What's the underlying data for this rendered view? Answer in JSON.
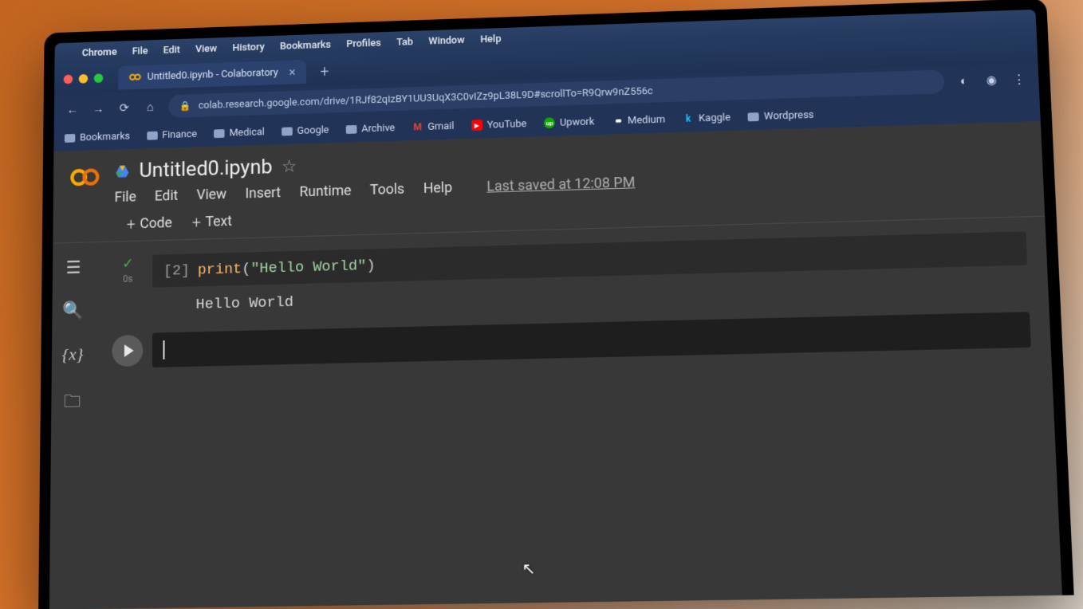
{
  "macos": {
    "app": "Chrome",
    "menus": [
      "File",
      "Edit",
      "View",
      "History",
      "Bookmarks",
      "Profiles",
      "Tab",
      "Window",
      "Help"
    ]
  },
  "browser": {
    "tab_title": "Untitled0.ipynb - Colaboratory",
    "url": "colab.research.google.com/drive/1RJf82qIzBY1UU3UqX3C0vIZz9pL38L9D#scrollTo=R9Qrw9nZ556c",
    "bookmarks": [
      {
        "label": "Bookmarks",
        "kind": "folder"
      },
      {
        "label": "Finance",
        "kind": "folder"
      },
      {
        "label": "Medical",
        "kind": "folder"
      },
      {
        "label": "Google",
        "kind": "folder"
      },
      {
        "label": "Archive",
        "kind": "folder"
      },
      {
        "label": "Gmail",
        "kind": "icon",
        "glyph": "M",
        "color": "#ea4335"
      },
      {
        "label": "YouTube",
        "kind": "icon",
        "glyph": "▶",
        "color": "#ff0000"
      },
      {
        "label": "Upwork",
        "kind": "icon",
        "glyph": "up",
        "color": "#14a800"
      },
      {
        "label": "Medium",
        "kind": "icon",
        "glyph": "●●",
        "color": "#ffffff"
      },
      {
        "label": "Kaggle",
        "kind": "icon",
        "glyph": "k",
        "color": "#20beff"
      },
      {
        "label": "Wordpress",
        "kind": "folder"
      }
    ]
  },
  "colab": {
    "doc_title": "Untitled0.ipynb",
    "menus": [
      "File",
      "Edit",
      "View",
      "Insert",
      "Runtime",
      "Tools",
      "Help"
    ],
    "toolbar": {
      "code_label": "Code",
      "text_label": "Text"
    },
    "last_saved": "Last saved at 12:08 PM",
    "cell1": {
      "exec_count": "[2]",
      "duration": "0s",
      "code_fn": "print",
      "code_str": "\"Hello World\"",
      "output": "Hello World"
    }
  }
}
